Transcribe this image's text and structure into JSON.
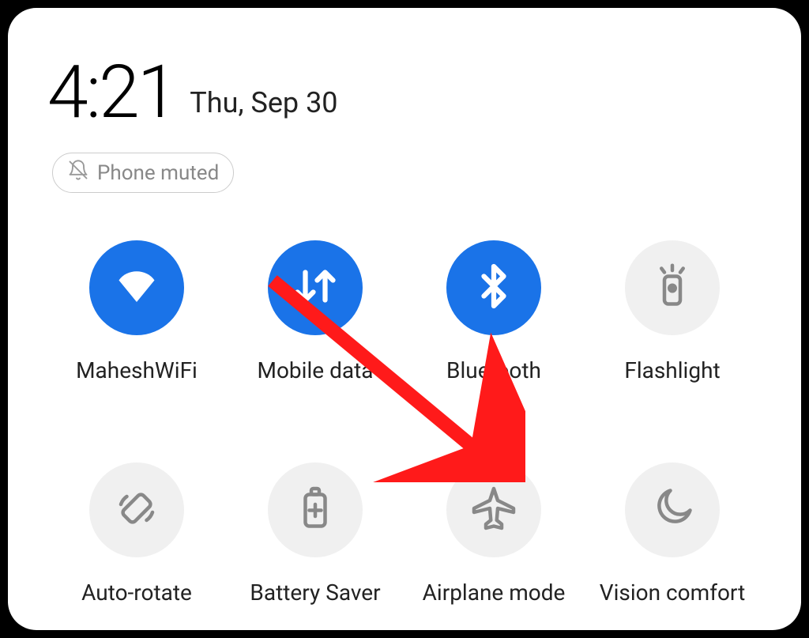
{
  "header": {
    "time": "4:21",
    "date": "Thu, Sep 30"
  },
  "mute_chip": {
    "label": "Phone muted"
  },
  "tiles": [
    {
      "label": "MaheshWiFi",
      "active": true
    },
    {
      "label": "Mobile data",
      "active": true
    },
    {
      "label": "Bluetooth",
      "active": true
    },
    {
      "label": "Flashlight",
      "active": false
    },
    {
      "label": "Auto-rotate",
      "active": false
    },
    {
      "label": "Battery Saver",
      "active": false
    },
    {
      "label": "Airplane mode",
      "active": false
    },
    {
      "label": "Vision comfort",
      "active": false
    }
  ],
  "colors": {
    "accent": "#1a73e8",
    "inactive_bg": "#f0f0f0",
    "inactive_fg": "#888888",
    "arrow": "#ff1a1a"
  },
  "annotation": {
    "arrow_target": "Airplane mode"
  }
}
